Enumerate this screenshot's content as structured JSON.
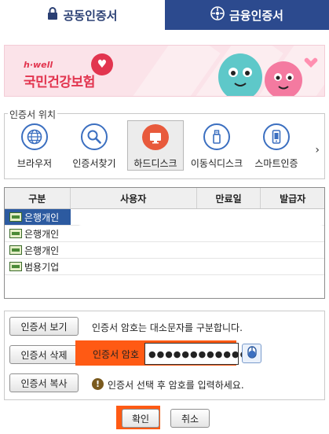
{
  "tabs": {
    "public_label": "공동인증서",
    "financial_label": "금융인증서"
  },
  "banner": {
    "brand_small": "h·well",
    "brand_name": "국민건강보험"
  },
  "location": {
    "legend": "인증서 위치",
    "items": [
      {
        "label": "브라우저",
        "icon": "globe-icon"
      },
      {
        "label": "인증서찾기",
        "icon": "search-icon"
      },
      {
        "label": "하드디스크",
        "icon": "monitor-icon",
        "selected": true
      },
      {
        "label": "이동식디스크",
        "icon": "usb-icon"
      },
      {
        "label": "스마트인증",
        "icon": "phone-icon"
      }
    ],
    "next_symbol": "›"
  },
  "table": {
    "headers": [
      "구분",
      "사용자",
      "만료일",
      "발급자"
    ],
    "rows": [
      {
        "type": "은행개인",
        "selected": true
      },
      {
        "type": "은행개인"
      },
      {
        "type": "은행개인"
      },
      {
        "type": "범용기업"
      }
    ]
  },
  "panel": {
    "view_button": "인증서 보기",
    "view_note": "인증서 암호는 대소문자를 구분합니다.",
    "delete_button": "인증서 삭제",
    "password_label": "인증서 암호",
    "password_value": "●●●●●●●●●●●●",
    "copy_button": "인증서 복사",
    "warning_text": "인증서 선택 후 암호를 입력하세요."
  },
  "footer": {
    "ok_label": "확인",
    "cancel_label": "취소"
  },
  "colors": {
    "tab_active": "#2c4a8e",
    "highlight": "#ff5a14",
    "selected_row": "#2c5aa0"
  }
}
